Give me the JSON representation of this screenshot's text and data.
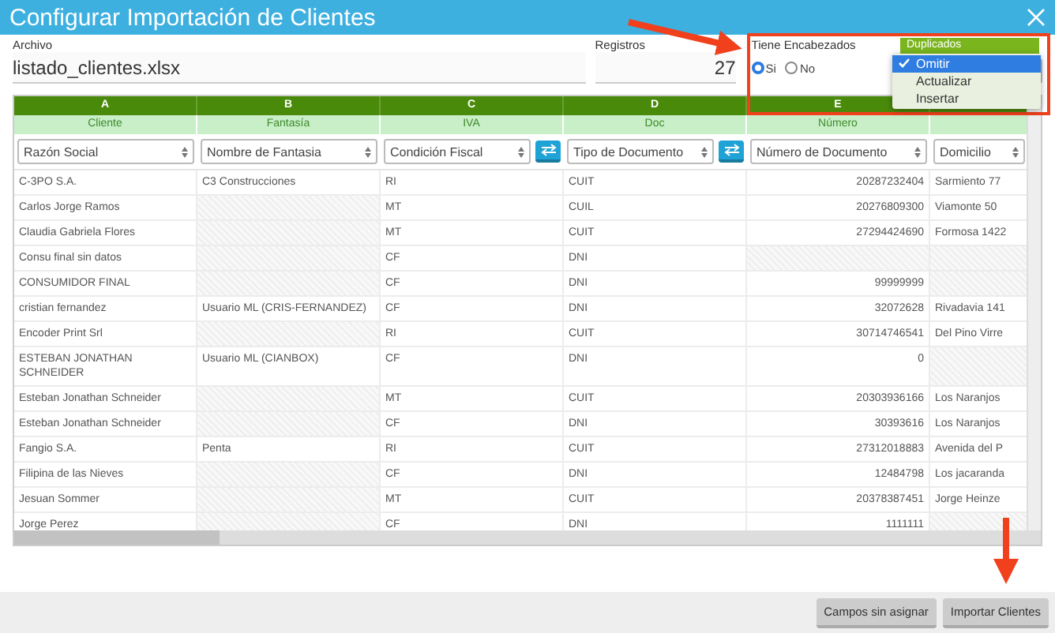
{
  "window": {
    "title": "Configurar Importación de Clientes"
  },
  "file": {
    "label": "Archivo",
    "value": "listado_clientes.xlsx"
  },
  "records": {
    "label": "Registros",
    "value": "27"
  },
  "headers_option": {
    "label": "Tiene Encabezados",
    "options": [
      {
        "label": "Si",
        "selected": true
      },
      {
        "label": "No",
        "selected": false
      }
    ]
  },
  "duplicates": {
    "label": "Duplicados",
    "options": [
      {
        "label": "Omitir",
        "selected": true
      },
      {
        "label": "Actualizar",
        "selected": false
      },
      {
        "label": "Insertar",
        "selected": false
      }
    ]
  },
  "table": {
    "columns": [
      {
        "letter": "A",
        "label": "Cliente",
        "mapping": "Razón Social",
        "swap": false,
        "kind": "text"
      },
      {
        "letter": "B",
        "label": "Fantasía",
        "mapping": "Nombre de Fantasia",
        "swap": false,
        "kind": "text"
      },
      {
        "letter": "C",
        "label": "IVA",
        "mapping": "Condición Fiscal",
        "swap": true,
        "kind": "text"
      },
      {
        "letter": "D",
        "label": "Doc",
        "mapping": "Tipo de Documento",
        "swap": true,
        "kind": "text"
      },
      {
        "letter": "E",
        "label": "Número",
        "mapping": "Número de Documento",
        "swap": false,
        "kind": "number"
      },
      {
        "mapping": "Domicilio",
        "swap": false,
        "kind": "text"
      }
    ],
    "rows": [
      [
        "C-3PO S.A.",
        "C3 Construcciones",
        "RI",
        "CUIT",
        "20287232404",
        "Sarmiento 77"
      ],
      [
        "Carlos Jorge Ramos",
        null,
        "MT",
        "CUIL",
        "20276809300",
        "Viamonte 50"
      ],
      [
        "Claudia Gabriela Flores",
        null,
        "MT",
        "CUIT",
        "27294424690",
        "Formosa 1422"
      ],
      [
        "Consu final sin datos",
        null,
        "CF",
        "DNI",
        null,
        null
      ],
      [
        "CONSUMIDOR FINAL",
        null,
        "CF",
        "DNI",
        "99999999",
        null
      ],
      [
        "cristian fernandez",
        "Usuario ML (CRIS-FERNANDEZ)",
        "CF",
        "DNI",
        "32072628",
        "Rivadavia 141"
      ],
      [
        "Encoder Print Srl",
        null,
        "RI",
        "CUIT",
        "30714746541",
        "Del Pino Virre"
      ],
      [
        "ESTEBAN JONATHAN SCHNEIDER",
        "Usuario ML (CIANBOX)",
        "CF",
        "DNI",
        "0",
        null
      ],
      [
        "Esteban Jonathan Schneider",
        null,
        "MT",
        "CUIT",
        "20303936166",
        "Los Naranjos"
      ],
      [
        "Esteban Jonathan Schneider",
        null,
        "CF",
        "DNI",
        "30393616",
        "Los Naranjos"
      ],
      [
        "Fangio S.A.",
        "Penta",
        "RI",
        "CUIT",
        "27312018883",
        "Avenida del P"
      ],
      [
        "Filipina de las Nieves",
        null,
        "CF",
        "DNI",
        "12484798",
        "Los jacaranda"
      ],
      [
        "Jesuan Sommer",
        null,
        "MT",
        "CUIT",
        "20378387451",
        "Jorge Heinze"
      ],
      [
        "Jorge Perez",
        null,
        "CF",
        "DNI",
        "1111111",
        null
      ]
    ]
  },
  "buttons": [
    {
      "label": "Campos sin asignar"
    },
    {
      "label": "Importar Clientes"
    }
  ]
}
